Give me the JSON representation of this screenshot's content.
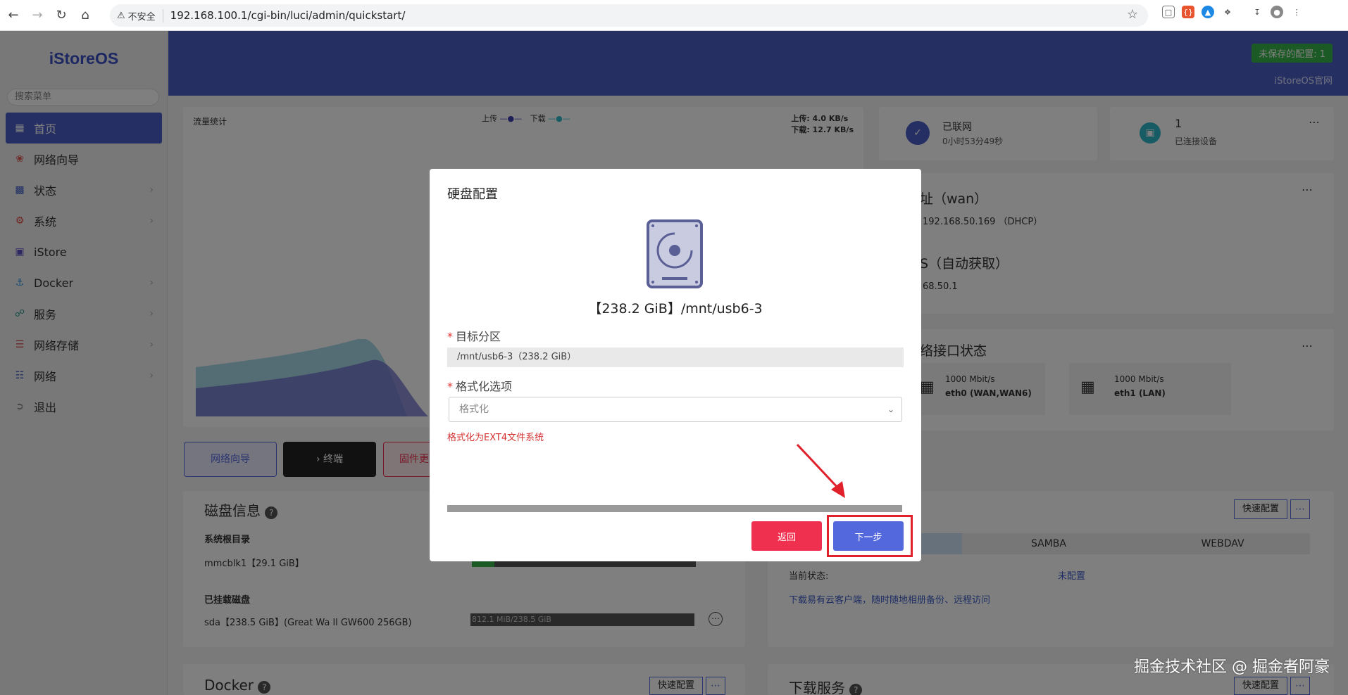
{
  "browser": {
    "insecure_label": "不安全",
    "url": "192.168.100.1/cgi-bin/luci/admin/quickstart/"
  },
  "app": {
    "logo": "iStoreOS",
    "search_placeholder": "搜索菜单",
    "unsaved": "未保存的配置: 1",
    "official_site": "iStoreOS官网",
    "menu": [
      {
        "label": "首页",
        "icon": "dashboard-icon",
        "active": true
      },
      {
        "label": "网络向导",
        "icon": "wizard-icon"
      },
      {
        "label": "状态",
        "icon": "status-icon"
      },
      {
        "label": "系统",
        "icon": "gear-icon"
      },
      {
        "label": "iStore",
        "icon": "store-icon"
      },
      {
        "label": "Docker",
        "icon": "docker-icon"
      },
      {
        "label": "服务",
        "icon": "service-icon"
      },
      {
        "label": "网络存储",
        "icon": "storage-icon"
      },
      {
        "label": "网络",
        "icon": "network-icon"
      },
      {
        "label": "退出",
        "icon": "logout-icon"
      }
    ]
  },
  "traffic": {
    "title": "流量统计",
    "legend_up": "上传",
    "legend_down": "下载",
    "up_rate": "上传: 4.0 KB/s",
    "down_rate": "下载: 12.7 KB/s"
  },
  "status_cards": {
    "connected": "已联网",
    "uptime": "0小时53分49秒",
    "device_count": "1",
    "device_label": "已连接设备",
    "wan_title": "址（wan）",
    "wan_ip": "192.168.50.169 （DHCP）",
    "dns_title": "S（自动获取）",
    "dns_value": "68.50.1",
    "iface_title": "络接口状态",
    "eth0_speed": "1000 Mbit/s",
    "eth0_name": "eth0 (WAN,WAN6)",
    "eth1_speed": "1000 Mbit/s",
    "eth1_name": "eth1 (LAN)"
  },
  "quick_buttons": {
    "wizard": "网络向导",
    "terminal": "终端",
    "firmware": "固件更"
  },
  "disk_info": {
    "title": "磁盘信息",
    "root_label": "系统根目录",
    "root_disk": "mmcblk1【29.1 GiB】",
    "mounted_label": "已挂载磁盘",
    "sda": "sda【238.5 GiB】(Great Wa ll GW600 256GB)",
    "sda_usage": "812.1 MiB/238.5 GiB"
  },
  "share": {
    "quick_config": "快速配置",
    "tab_samba": "SAMBA",
    "tab_webdav": "WEBDAV",
    "status_label": "当前状态:",
    "status_value": "未配置",
    "tip": "下载易有云客户端，随时随地相册备份、远程访问"
  },
  "bottom": {
    "docker_title": "Docker",
    "docker_quick": "快速配置",
    "download_title": "下载服务",
    "download_quick": "快速配置"
  },
  "dialog": {
    "title": "硬盘配置",
    "disk_label": "【238.2 GiB】/mnt/usb6-3",
    "target_label": "目标分区",
    "target_value": "/mnt/usb6-3（238.2 GiB）",
    "format_label": "格式化选项",
    "format_value": "格式化",
    "format_note": "格式化为EXT4文件系统",
    "back": "返回",
    "next": "下一步"
  },
  "watermark": "掘金技术社区 @ 掘金者阿豪"
}
